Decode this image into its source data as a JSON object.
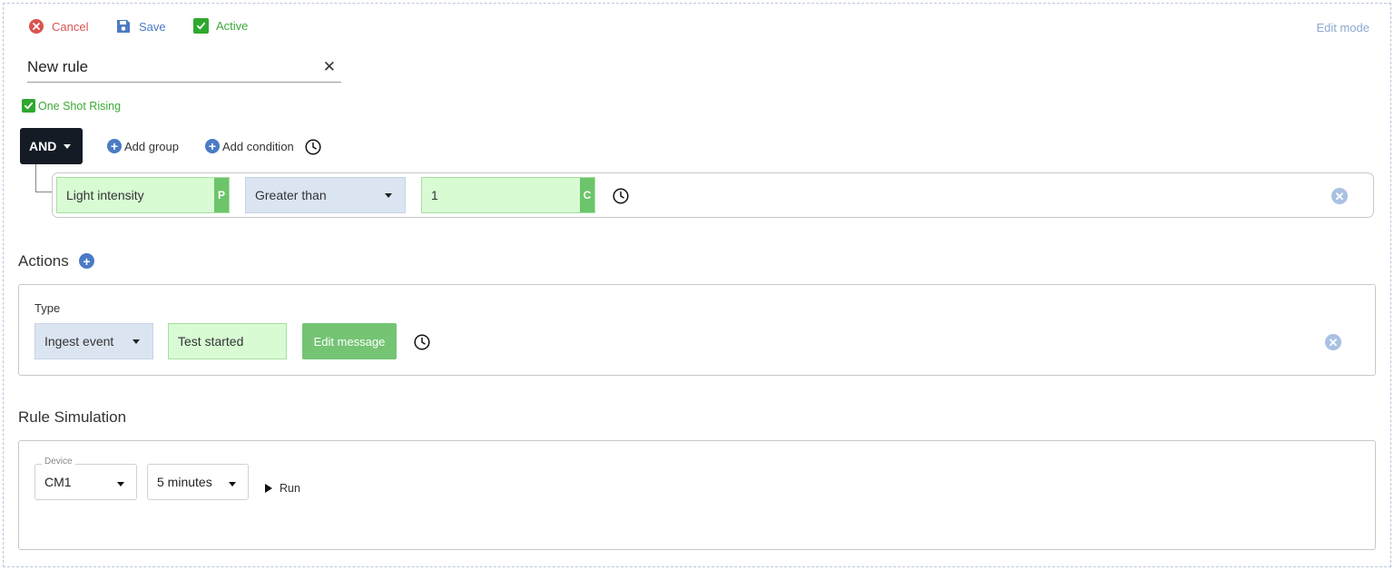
{
  "toolbar": {
    "cancel_label": "Cancel",
    "save_label": "Save",
    "active_label": "Active",
    "mode_label": "Edit mode"
  },
  "rule": {
    "name": "New rule",
    "one_shot_label": "One Shot Rising",
    "one_shot_checked": true,
    "active_checked": true
  },
  "conditions": {
    "operator": "AND",
    "add_group_label": "Add group",
    "add_condition_label": "Add condition",
    "items": [
      {
        "property": "Light intensity",
        "property_tag": "P",
        "comparator": "Greater than",
        "value": "1",
        "value_tag": "C"
      }
    ]
  },
  "actions": {
    "title": "Actions",
    "type_label": "Type",
    "items": [
      {
        "type": "Ingest event",
        "message": "Test started",
        "edit_label": "Edit message"
      }
    ]
  },
  "simulation": {
    "title": "Rule Simulation",
    "device_label": "Device",
    "device_value": "CM1",
    "duration_value": "5 minutes",
    "run_label": "Run"
  },
  "colors": {
    "cancel": "#d9534f",
    "save": "#4a7bc4",
    "active": "#3aaa35",
    "operator_bg": "#141b24",
    "field_green": "#d8fbd4",
    "tag_green": "#6cc56a",
    "select_blue": "#dbe5f2"
  }
}
